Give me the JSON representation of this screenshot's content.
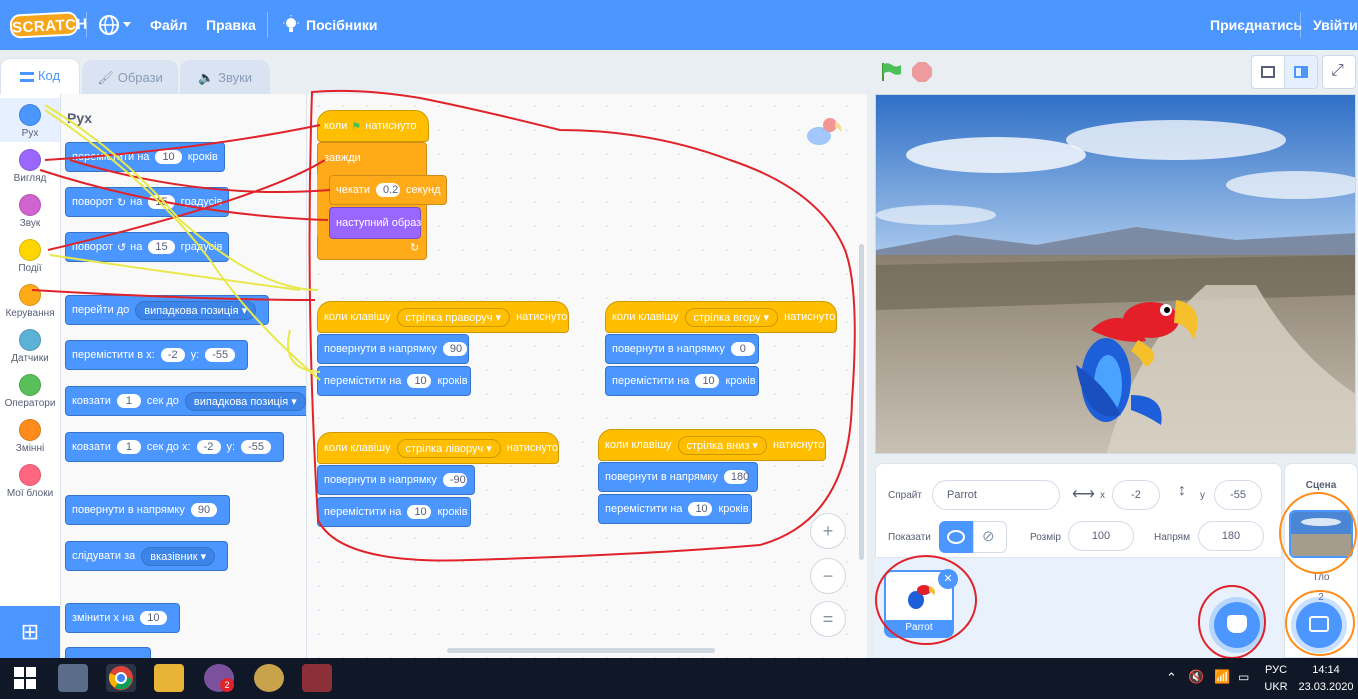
{
  "topbar": {
    "logo": "SCRATCH",
    "menu_file": "Файл",
    "menu_edit": "Правка",
    "menu_tutorials": "Посібники",
    "join": "Приєднатись",
    "signin": "Увійти"
  },
  "tabs": {
    "code": "Код",
    "costumes": "Образи",
    "sounds": "Звуки"
  },
  "categories": [
    {
      "label": "Рух",
      "color": "#4c97ff"
    },
    {
      "label": "Вигляд",
      "color": "#9966ff"
    },
    {
      "label": "Звук",
      "color": "#cf63cf"
    },
    {
      "label": "Події",
      "color": "#ffd500"
    },
    {
      "label": "Керування",
      "color": "#ffab19"
    },
    {
      "label": "Датчики",
      "color": "#5cb1d6"
    },
    {
      "label": "Оператори",
      "color": "#59c059"
    },
    {
      "label": "Змінні",
      "color": "#ff8c1a"
    },
    {
      "label": "Мої блоки",
      "color": "#ff6680"
    }
  ],
  "palette": {
    "title": "Рух",
    "move": {
      "a": "перемістити на",
      "v": "10",
      "b": "кроків"
    },
    "turn_right": {
      "a": "поворот",
      "b": "на",
      "v": "15",
      "c": "градусів"
    },
    "turn_left": {
      "a": "поворот",
      "b": "на",
      "v": "15",
      "c": "градусів"
    },
    "goto": {
      "a": "перейти до",
      "dd": "випадкова позиція"
    },
    "goto_xy": {
      "a": "перемістити в x:",
      "x": "-2",
      "b": "y:",
      "y": "-55"
    },
    "glide": {
      "a": "ковзати",
      "v": "1",
      "b": "сек до",
      "dd": "випадкова позиція"
    },
    "glide_xy": {
      "a": "ковзати",
      "v": "1",
      "b": "сек до x:",
      "x": "-2",
      "c": "у:",
      "y": "-55"
    },
    "point": {
      "a": "повернути в напрямку",
      "v": "90"
    },
    "follow": {
      "a": "слідувати за",
      "dd": "вказівник"
    },
    "change_x": {
      "a": "змінити х на",
      "v": "10"
    }
  },
  "scripts": {
    "flag_script": {
      "when": "коли",
      "clicked": "натиснуто",
      "forever": "завжди",
      "wait": "чекати",
      "wait_v": "0.2",
      "seconds": "секунд",
      "next": "наступний образ"
    },
    "right": {
      "when": "коли клавішу",
      "key": "стрілка праворуч",
      "pressed": "натиснуто",
      "point": "повернути в напрямку",
      "dir": "90",
      "move": "перемістити на",
      "steps_v": "10",
      "steps": "кроків"
    },
    "up": {
      "when": "коли клавішу",
      "key": "стрілка вгору",
      "pressed": "натиснуто",
      "point": "повернути в напрямку",
      "dir": "0",
      "move": "перемістити на",
      "steps_v": "10",
      "steps": "кроків"
    },
    "left": {
      "when": "коли клавішу",
      "key": "стрілка ліворуч",
      "pressed": "натиснуто",
      "point": "повернути в напрямку",
      "dir": "-90",
      "move": "перемістити на",
      "steps_v": "10",
      "steps": "кроків"
    },
    "down": {
      "when": "коли клавішу",
      "key": "стрілка вниз",
      "pressed": "натиснуто",
      "point": "повернути в напрямку",
      "dir": "180",
      "move": "перемістити на",
      "steps_v": "10",
      "steps": "кроків"
    }
  },
  "zoom": {
    "in": "+",
    "out": "−",
    "reset": "="
  },
  "sprite_info": {
    "sprite_label": "Спрайт",
    "sprite_name": "Parrot",
    "x_label": "x",
    "x": "-2",
    "y_label": "у",
    "y": "-55",
    "show_label": "Показати",
    "size_label": "Розмір",
    "size": "100",
    "direction_label": "Напрям",
    "direction": "180"
  },
  "sprite_tile": {
    "name": "Parrot"
  },
  "stage_panel": {
    "title": "Сцена",
    "backdrops_label": "Тло",
    "backdrops_count": "2"
  },
  "taskbar": {
    "lang": "РУС",
    "layout": "UKR",
    "time": "14:14",
    "date": "23.03.2020",
    "viber_badge": "2"
  },
  "colors": {
    "accent": "#4c97ff",
    "annotation_red": "#e0232a",
    "annotation_yellow": "#e8e84a",
    "annotation_orange": "#ff8c1a"
  }
}
